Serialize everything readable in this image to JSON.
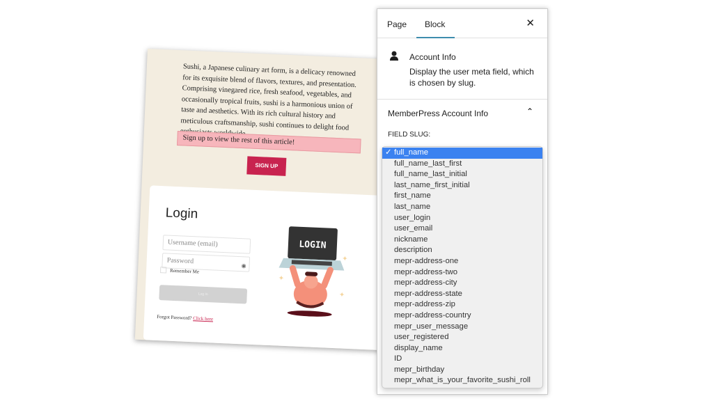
{
  "article": {
    "body": "Sushi, a Japanese culinary art form, is a delicacy renowned for its exquisite blend of flavors, textures, and presentation. Comprising vinegared rice, fresh seafood, vegetables, and occasionally tropical fruits, sushi is a harmonious union of taste and aesthetics. With its rich cultural history and meticulous craftsmanship, sushi continues to delight food enthusiasts worldwide.",
    "notice": "Sign up to view the rest of this article!",
    "signup_label": "SIGN UP"
  },
  "login": {
    "title": "Login",
    "username_placeholder": "Username (email)",
    "password_placeholder": "Password",
    "remember_label": "Remember Me",
    "button_label": "Log In",
    "forgot_text": "Forgot Password?",
    "forgot_link": "Click here",
    "illustration_text": "LOGIN"
  },
  "panel": {
    "tabs": [
      {
        "label": "Page"
      },
      {
        "label": "Block",
        "active": true
      }
    ],
    "close_icon": "close-icon",
    "block": {
      "icon": "user-icon",
      "title": "Account Info",
      "description": "Display the user meta field, which is chosen by slug."
    },
    "section_title": "MemberPress Account Info",
    "field_label": "FIELD SLUG:",
    "selected": "full_name",
    "options": [
      "full_name",
      "full_name_last_first",
      "full_name_last_initial",
      "last_name_first_initial",
      "first_name",
      "last_name",
      "user_login",
      "user_email",
      "nickname",
      "description",
      "mepr-address-one",
      "mepr-address-two",
      "mepr-address-city",
      "mepr-address-state",
      "mepr-address-zip",
      "mepr-address-country",
      "mepr_user_message",
      "user_registered",
      "display_name",
      "ID",
      "mepr_birthday",
      "mepr_what_is_your_favorite_sushi_roll"
    ]
  },
  "colors": {
    "accent": "#c8234f",
    "tab_underline": "#3e8dad",
    "selection": "#3b82f0",
    "card_bg": "#f3ede0"
  }
}
